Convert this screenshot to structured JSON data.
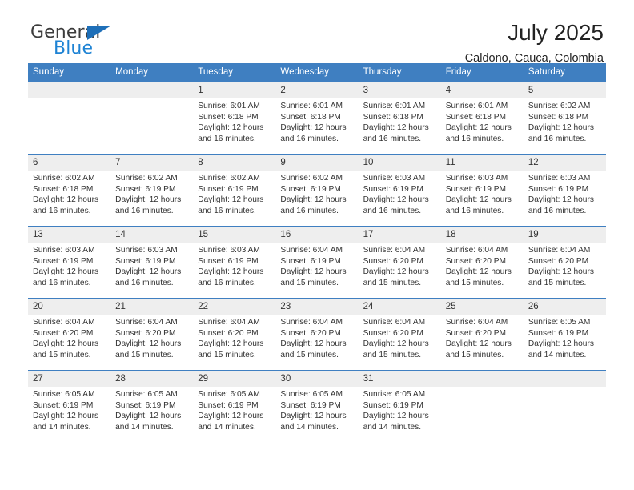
{
  "brand": {
    "name_part1": "General",
    "name_part2": "Blue",
    "triangle_icon": "triangle-icon",
    "color_dark": "#3c3c3c",
    "color_blue": "#1e83d4"
  },
  "header": {
    "title": "July 2025",
    "subtitle": "Caldono, Cauca, Colombia"
  },
  "theme": {
    "header_blue": "#3f7fc1",
    "daynum_bg": "#eeeeee",
    "text": "#333333"
  },
  "calendar": {
    "weekdays": [
      "Sunday",
      "Monday",
      "Tuesday",
      "Wednesday",
      "Thursday",
      "Friday",
      "Saturday"
    ],
    "labels": {
      "sunrise": "Sunrise:",
      "sunset": "Sunset:",
      "daylight": "Daylight:"
    },
    "weeks": [
      [
        {
          "day": "",
          "empty": true,
          "line1": "",
          "line2": "",
          "line3": "",
          "line4": ""
        },
        {
          "day": "",
          "empty": true,
          "line1": "",
          "line2": "",
          "line3": "",
          "line4": ""
        },
        {
          "day": "1",
          "empty": false,
          "line1": "Sunrise: 6:01 AM",
          "line2": "Sunset: 6:18 PM",
          "line3": "Daylight: 12 hours",
          "line4": "and 16 minutes."
        },
        {
          "day": "2",
          "empty": false,
          "line1": "Sunrise: 6:01 AM",
          "line2": "Sunset: 6:18 PM",
          "line3": "Daylight: 12 hours",
          "line4": "and 16 minutes."
        },
        {
          "day": "3",
          "empty": false,
          "line1": "Sunrise: 6:01 AM",
          "line2": "Sunset: 6:18 PM",
          "line3": "Daylight: 12 hours",
          "line4": "and 16 minutes."
        },
        {
          "day": "4",
          "empty": false,
          "line1": "Sunrise: 6:01 AM",
          "line2": "Sunset: 6:18 PM",
          "line3": "Daylight: 12 hours",
          "line4": "and 16 minutes."
        },
        {
          "day": "5",
          "empty": false,
          "line1": "Sunrise: 6:02 AM",
          "line2": "Sunset: 6:18 PM",
          "line3": "Daylight: 12 hours",
          "line4": "and 16 minutes."
        }
      ],
      [
        {
          "day": "6",
          "empty": false,
          "line1": "Sunrise: 6:02 AM",
          "line2": "Sunset: 6:18 PM",
          "line3": "Daylight: 12 hours",
          "line4": "and 16 minutes."
        },
        {
          "day": "7",
          "empty": false,
          "line1": "Sunrise: 6:02 AM",
          "line2": "Sunset: 6:19 PM",
          "line3": "Daylight: 12 hours",
          "line4": "and 16 minutes."
        },
        {
          "day": "8",
          "empty": false,
          "line1": "Sunrise: 6:02 AM",
          "line2": "Sunset: 6:19 PM",
          "line3": "Daylight: 12 hours",
          "line4": "and 16 minutes."
        },
        {
          "day": "9",
          "empty": false,
          "line1": "Sunrise: 6:02 AM",
          "line2": "Sunset: 6:19 PM",
          "line3": "Daylight: 12 hours",
          "line4": "and 16 minutes."
        },
        {
          "day": "10",
          "empty": false,
          "line1": "Sunrise: 6:03 AM",
          "line2": "Sunset: 6:19 PM",
          "line3": "Daylight: 12 hours",
          "line4": "and 16 minutes."
        },
        {
          "day": "11",
          "empty": false,
          "line1": "Sunrise: 6:03 AM",
          "line2": "Sunset: 6:19 PM",
          "line3": "Daylight: 12 hours",
          "line4": "and 16 minutes."
        },
        {
          "day": "12",
          "empty": false,
          "line1": "Sunrise: 6:03 AM",
          "line2": "Sunset: 6:19 PM",
          "line3": "Daylight: 12 hours",
          "line4": "and 16 minutes."
        }
      ],
      [
        {
          "day": "13",
          "empty": false,
          "line1": "Sunrise: 6:03 AM",
          "line2": "Sunset: 6:19 PM",
          "line3": "Daylight: 12 hours",
          "line4": "and 16 minutes."
        },
        {
          "day": "14",
          "empty": false,
          "line1": "Sunrise: 6:03 AM",
          "line2": "Sunset: 6:19 PM",
          "line3": "Daylight: 12 hours",
          "line4": "and 16 minutes."
        },
        {
          "day": "15",
          "empty": false,
          "line1": "Sunrise: 6:03 AM",
          "line2": "Sunset: 6:19 PM",
          "line3": "Daylight: 12 hours",
          "line4": "and 16 minutes."
        },
        {
          "day": "16",
          "empty": false,
          "line1": "Sunrise: 6:04 AM",
          "line2": "Sunset: 6:19 PM",
          "line3": "Daylight: 12 hours",
          "line4": "and 15 minutes."
        },
        {
          "day": "17",
          "empty": false,
          "line1": "Sunrise: 6:04 AM",
          "line2": "Sunset: 6:20 PM",
          "line3": "Daylight: 12 hours",
          "line4": "and 15 minutes."
        },
        {
          "day": "18",
          "empty": false,
          "line1": "Sunrise: 6:04 AM",
          "line2": "Sunset: 6:20 PM",
          "line3": "Daylight: 12 hours",
          "line4": "and 15 minutes."
        },
        {
          "day": "19",
          "empty": false,
          "line1": "Sunrise: 6:04 AM",
          "line2": "Sunset: 6:20 PM",
          "line3": "Daylight: 12 hours",
          "line4": "and 15 minutes."
        }
      ],
      [
        {
          "day": "20",
          "empty": false,
          "line1": "Sunrise: 6:04 AM",
          "line2": "Sunset: 6:20 PM",
          "line3": "Daylight: 12 hours",
          "line4": "and 15 minutes."
        },
        {
          "day": "21",
          "empty": false,
          "line1": "Sunrise: 6:04 AM",
          "line2": "Sunset: 6:20 PM",
          "line3": "Daylight: 12 hours",
          "line4": "and 15 minutes."
        },
        {
          "day": "22",
          "empty": false,
          "line1": "Sunrise: 6:04 AM",
          "line2": "Sunset: 6:20 PM",
          "line3": "Daylight: 12 hours",
          "line4": "and 15 minutes."
        },
        {
          "day": "23",
          "empty": false,
          "line1": "Sunrise: 6:04 AM",
          "line2": "Sunset: 6:20 PM",
          "line3": "Daylight: 12 hours",
          "line4": "and 15 minutes."
        },
        {
          "day": "24",
          "empty": false,
          "line1": "Sunrise: 6:04 AM",
          "line2": "Sunset: 6:20 PM",
          "line3": "Daylight: 12 hours",
          "line4": "and 15 minutes."
        },
        {
          "day": "25",
          "empty": false,
          "line1": "Sunrise: 6:04 AM",
          "line2": "Sunset: 6:20 PM",
          "line3": "Daylight: 12 hours",
          "line4": "and 15 minutes."
        },
        {
          "day": "26",
          "empty": false,
          "line1": "Sunrise: 6:05 AM",
          "line2": "Sunset: 6:19 PM",
          "line3": "Daylight: 12 hours",
          "line4": "and 14 minutes."
        }
      ],
      [
        {
          "day": "27",
          "empty": false,
          "line1": "Sunrise: 6:05 AM",
          "line2": "Sunset: 6:19 PM",
          "line3": "Daylight: 12 hours",
          "line4": "and 14 minutes."
        },
        {
          "day": "28",
          "empty": false,
          "line1": "Sunrise: 6:05 AM",
          "line2": "Sunset: 6:19 PM",
          "line3": "Daylight: 12 hours",
          "line4": "and 14 minutes."
        },
        {
          "day": "29",
          "empty": false,
          "line1": "Sunrise: 6:05 AM",
          "line2": "Sunset: 6:19 PM",
          "line3": "Daylight: 12 hours",
          "line4": "and 14 minutes."
        },
        {
          "day": "30",
          "empty": false,
          "line1": "Sunrise: 6:05 AM",
          "line2": "Sunset: 6:19 PM",
          "line3": "Daylight: 12 hours",
          "line4": "and 14 minutes."
        },
        {
          "day": "31",
          "empty": false,
          "line1": "Sunrise: 6:05 AM",
          "line2": "Sunset: 6:19 PM",
          "line3": "Daylight: 12 hours",
          "line4": "and 14 minutes."
        },
        {
          "day": "",
          "empty": true,
          "line1": "",
          "line2": "",
          "line3": "",
          "line4": ""
        },
        {
          "day": "",
          "empty": true,
          "line1": "",
          "line2": "",
          "line3": "",
          "line4": ""
        }
      ]
    ]
  }
}
